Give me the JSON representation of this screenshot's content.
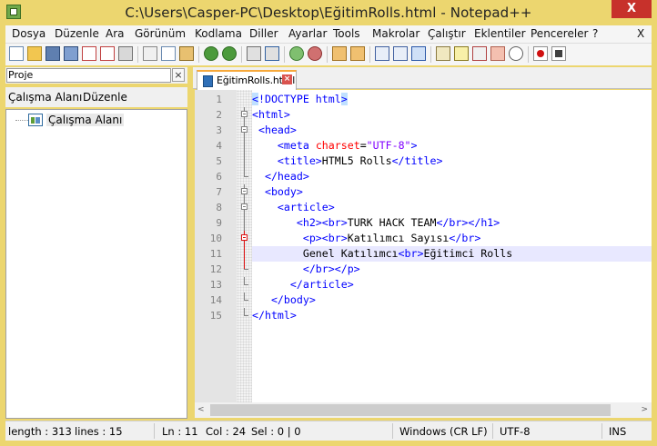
{
  "window": {
    "title": "C:\\Users\\Casper-PC\\Desktop\\EğitimRolls.html - Notepad++",
    "close_glyph": "X"
  },
  "menu": [
    "Dosya",
    "Düzenle",
    "Ara",
    "Görünüm",
    "Kodlama",
    "Diller",
    "Ayarlar",
    "Tools",
    "Makrolar",
    "Çalıştır",
    "Eklentiler",
    "Pencereler",
    "?",
    "X"
  ],
  "toolbar_icons": [
    "new-file-icon",
    "open-file-icon",
    "save-icon",
    "save-all-icon",
    "close-icon",
    "close-all-icon",
    "print-icon",
    "cut-icon",
    "copy-icon",
    "paste-icon",
    "undo-icon",
    "redo-icon",
    "find-icon",
    "replace-icon",
    "zoom-in-icon",
    "zoom-out-icon",
    "sync-vertical-icon",
    "sync-horizontal-icon",
    "word-wrap-icon",
    "show-all-chars-icon",
    "indent-guide-icon",
    "user-lang-icon",
    "doc-map-icon",
    "function-list-icon",
    "folder-workspace-icon",
    "monitoring-icon",
    "record-macro-icon",
    "stop-record-icon"
  ],
  "project_panel": {
    "title": "Proje",
    "close_glyph": "×",
    "menu": [
      "Çalışma Alanı",
      "Düzenle"
    ],
    "tree": [
      {
        "label": "Çalışma Alanı"
      }
    ]
  },
  "editor": {
    "tab": {
      "label": "EğitimRolls.html",
      "close_glyph": "×"
    },
    "current_line": 11,
    "lines": [
      {
        "num": "1",
        "html": "<span class=\"hl\"><span class=\"tag\">&lt;</span></span><span class=\"tag\">!DOCTYPE html</span><span class=\"hl\"><span class=\"tag\">&gt;</span></span>"
      },
      {
        "num": "2",
        "html": "<span class=\"tag\">&lt;html&gt;</span>"
      },
      {
        "num": "3",
        "html": " <span class=\"tag\">&lt;head&gt;</span>"
      },
      {
        "num": "4",
        "html": "    <span class=\"tag\">&lt;meta</span> <span class=\"attr\">charset</span>=<span class=\"str\">\"UTF-8\"</span><span class=\"tag\">&gt;</span>"
      },
      {
        "num": "5",
        "html": "    <span class=\"tag\">&lt;title&gt;</span>HTML5 Rolls<span class=\"tag\">&lt;/title&gt;</span>"
      },
      {
        "num": "6",
        "html": "  <span class=\"tag\">&lt;/head&gt;</span>"
      },
      {
        "num": "7",
        "html": "  <span class=\"tag\">&lt;body&gt;</span>"
      },
      {
        "num": "8",
        "html": "    <span class=\"tag\">&lt;article&gt;</span>"
      },
      {
        "num": "9",
        "html": "       <span class=\"tag\">&lt;h2&gt;&lt;br&gt;</span>TURK HACK TEAM<span class=\"tag\">&lt;/br&gt;&lt;/h1&gt;</span>"
      },
      {
        "num": "10",
        "html": "        <span class=\"tag\">&lt;p&gt;&lt;br&gt;</span>Katılımcı Sayısı<span class=\"tag\">&lt;/br&gt;</span>"
      },
      {
        "num": "11",
        "html": "        Genel Katılımcı<span class=\"tag\">&lt;br&gt;</span>Eğitimci Rolls"
      },
      {
        "num": "12",
        "html": "        <span class=\"tag\">&lt;/br&gt;&lt;/p&gt;</span>"
      },
      {
        "num": "13",
        "html": "      <span class=\"tag\">&lt;/article&gt;</span>"
      },
      {
        "num": "14",
        "html": "   <span class=\"tag\">&lt;/body&gt;</span>"
      },
      {
        "num": "15",
        "html": "<span class=\"tag\">&lt;/html&gt;</span>"
      }
    ]
  },
  "scrollbar": {
    "left_arrow": "<",
    "right_arrow": ">"
  },
  "status": {
    "length": "length : 313",
    "lines": "lines : 15",
    "ln": "Ln : 11",
    "col": "Col : 24",
    "sel": "Sel : 0 | 0",
    "eol": "Windows (CR LF)",
    "encoding": "UTF-8",
    "mode": "INS"
  },
  "colors": {
    "title_bar": "#ecd66f",
    "close_button": "#c7312b",
    "tag": "#0000ff",
    "attribute": "#ff0000",
    "string": "#8000ff",
    "current_line": "#e8e8ff"
  }
}
